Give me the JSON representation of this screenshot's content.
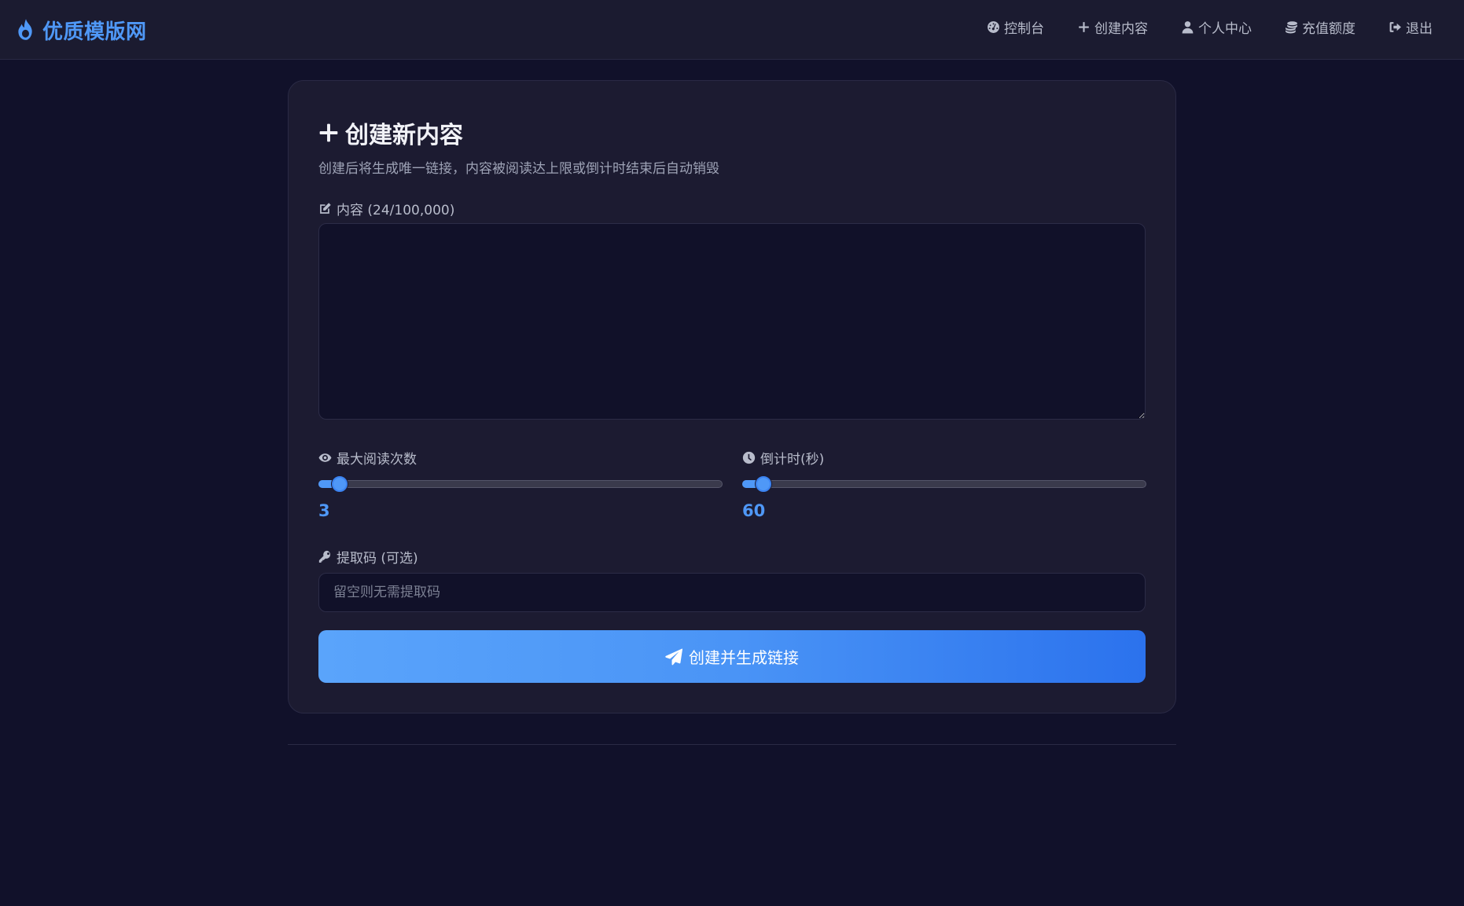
{
  "brand": {
    "name": "优质模版网",
    "icon": "fire-icon",
    "color": "#4f98f7"
  },
  "nav": {
    "items": [
      {
        "label": "控制台",
        "icon": "dashboard-icon"
      },
      {
        "label": "创建内容",
        "icon": "plus-icon"
      },
      {
        "label": "个人中心",
        "icon": "user-icon"
      },
      {
        "label": "充值额度",
        "icon": "coins-icon"
      },
      {
        "label": "退出",
        "icon": "sign-out-icon"
      }
    ]
  },
  "form": {
    "title": "创建新内容",
    "subtitle": "创建后将生成唯一链接，内容被阅读达上限或倒计时结束后自动销毁",
    "content": {
      "label": "内容 (24/100,000)",
      "value": ""
    },
    "max_reads": {
      "label": "最大阅读次数",
      "value": "3",
      "fill_fraction": 0.035
    },
    "countdown": {
      "label": "倒计时(秒)",
      "value": "60",
      "fill_fraction": 0.035
    },
    "access_code": {
      "label": "提取码 (可选)",
      "placeholder": "留空则无需提取码",
      "value": ""
    },
    "submit_label": "创建并生成链接"
  },
  "colors": {
    "background": "#11112a",
    "card": "#1c1b31",
    "accent": "#4f98f7",
    "button_gradient_start": "#5aa4fb",
    "button_gradient_end": "#2b72ed"
  }
}
